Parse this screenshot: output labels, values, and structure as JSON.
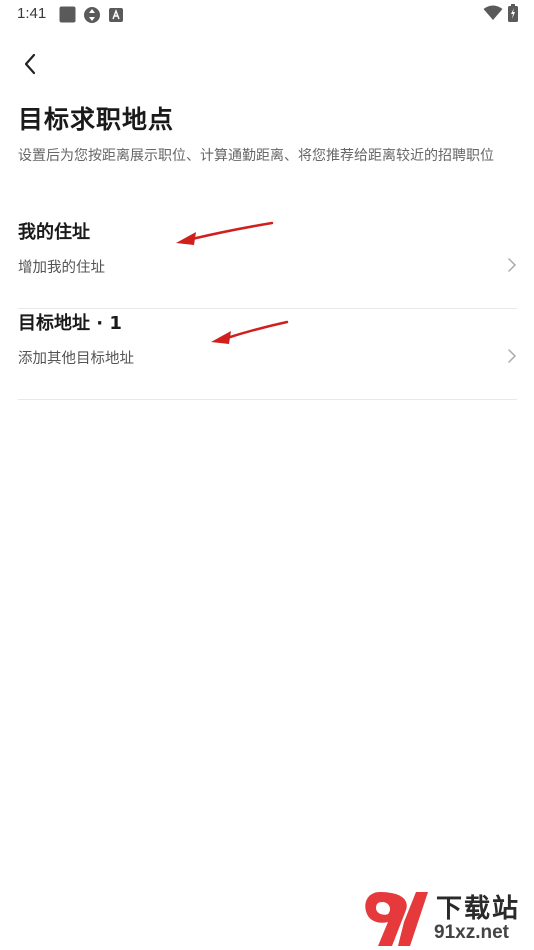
{
  "status_bar": {
    "time": "1:41",
    "left_icons": [
      "square-notification-icon",
      "sync-icon",
      "a-icon"
    ],
    "right_icons": [
      "wifi-icon",
      "battery-icon"
    ]
  },
  "header": {
    "back_icon": "chevron-left-icon",
    "title": "目标求职地点",
    "description": "设置后为您按距离展示职位、计算通勤距离、将您推荐给距离较近的招聘职位"
  },
  "sections": [
    {
      "title": "我的住址",
      "subtitle": "增加我的住址",
      "icon": "chevron-right-icon"
    },
    {
      "title": "目标地址 · 1",
      "subtitle": "添加其他目标地址",
      "icon": "chevron-right-icon"
    }
  ],
  "annotations": {
    "arrow_color": "#d0201e"
  },
  "watermark": {
    "cn": "下载站",
    "en": "91xz.net",
    "logo": "91-logo"
  },
  "colors": {
    "background": "#ffffff",
    "title": "#1a1a1a",
    "secondary": "#666666",
    "divider": "#e8e8e8"
  }
}
